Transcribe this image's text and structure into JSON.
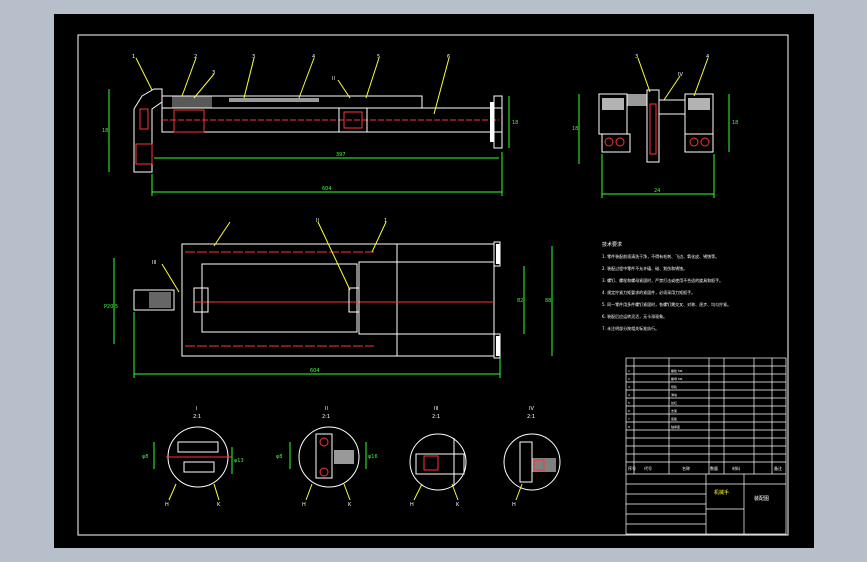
{
  "drawing": {
    "background_color": "#000000",
    "outside_color": "#b6bfca",
    "line_colors": {
      "outline": "#ffffff",
      "hatch": "#ff3333",
      "dimension": "#33ff33",
      "leader": "#ffff33",
      "fill": "#ffffff"
    },
    "view1": {
      "labels": [
        "1",
        "2",
        "3",
        "3",
        "4",
        "II",
        "5",
        "6"
      ],
      "dims": {
        "height": "18",
        "total": "604",
        "mid": "397",
        "right": "18"
      }
    },
    "view2": {
      "labels": [
        "3",
        "IV",
        "4"
      ],
      "dims": {
        "height": "18",
        "right": "18",
        "bottom": "24"
      }
    },
    "view3": {
      "labels": [
        "III",
        "II",
        "1"
      ],
      "dims": {
        "left": "P20.5",
        "right1": "82",
        "right2": "88",
        "bottom": "604"
      }
    },
    "details": [
      {
        "title": "I",
        "scale": "2:1",
        "dims": [
          "φ8",
          "φ13"
        ],
        "tags": [
          "H",
          "K"
        ]
      },
      {
        "title": "II",
        "scale": "2:1",
        "dims": [
          "φ8",
          "φ16"
        ],
        "tags": [
          "H",
          "K"
        ]
      },
      {
        "title": "III",
        "scale": "2:1",
        "dims": [],
        "tags": [
          "H",
          "K"
        ]
      },
      {
        "title": "IV",
        "scale": "2:1",
        "dims": [],
        "tags": [
          "H"
        ]
      }
    ],
    "notes": {
      "title": "技术要求",
      "lines": [
        "1. 零件装配前须清洗干净，不得有毛刺、飞边、氧化皮、锈蚀等。",
        "2. 装配过程中零件不允许磕、碰、划伤和锈蚀。",
        "3. 螺钉、螺栓和螺母紧固时，严禁打击或使用不合适的旋具和扳手。",
        "4. 规定拧紧力矩要求的紧固件，必须采用力矩扳手。",
        "5. 同一零件用多件螺钉紧固时，各螺钉需交叉、对称、逐步、均匀拧紧。",
        "6. 装配后应运转灵活，无卡滞现象。",
        "7. 未注明部分按相关标准执行。"
      ]
    },
    "title_block": {
      "drawing_name": "机械手",
      "company": "装配图",
      "header_cells": [
        "序号",
        "代号",
        "名称",
        "数量",
        "材料",
        "备注"
      ],
      "rows": [
        [
          "1",
          "GB/T 5783",
          "螺栓 M6",
          "4",
          "Q235",
          ""
        ],
        [
          "2",
          "GB/T 6170",
          "螺母 M6",
          "4",
          "Q235",
          ""
        ],
        [
          "3",
          "",
          "导轨",
          "2",
          "45",
          ""
        ],
        [
          "4",
          "",
          "滑块",
          "2",
          "45",
          ""
        ],
        [
          "5",
          "",
          "丝杠",
          "1",
          "45",
          ""
        ],
        [
          "6",
          "",
          "支架",
          "1",
          "HT200",
          ""
        ],
        [
          "7",
          "",
          "底板",
          "1",
          "Q235",
          ""
        ],
        [
          "8",
          "",
          "轴承座",
          "2",
          "HT200",
          ""
        ]
      ]
    }
  }
}
